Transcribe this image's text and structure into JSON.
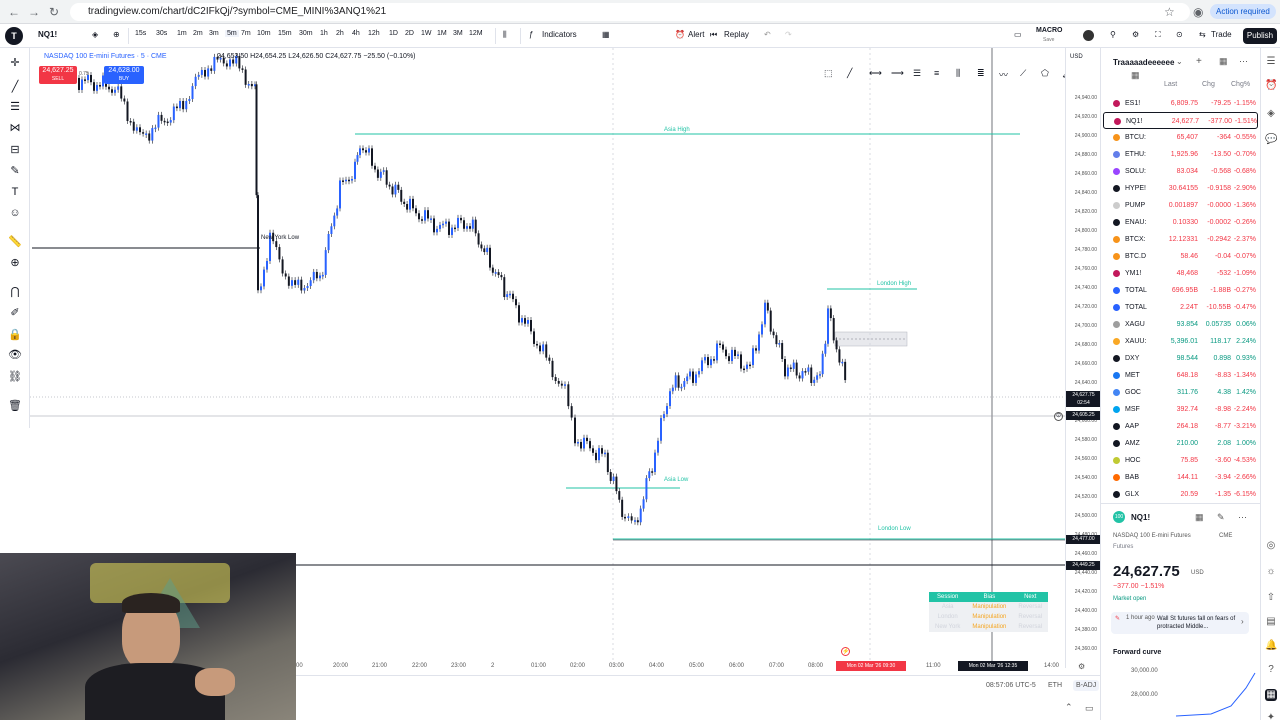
{
  "browser": {
    "url": "tradingview.com/chart/dC2IFkQj/?symbol=CME_MINI%3ANQ1%21",
    "action_required": "Action required"
  },
  "toolbar": {
    "symbol": "NQ1!",
    "intervals": [
      "15s",
      "30s",
      "1m",
      "2m",
      "3m",
      "5m",
      "7m",
      "10m",
      "15m",
      "30m",
      "1h",
      "2h",
      "4h",
      "12h",
      "1D",
      "2D",
      "1W",
      "1M",
      "3M",
      "12M"
    ],
    "indicators": "Indicators",
    "alert": "Alert",
    "replay": "Replay",
    "macro": "MACRO",
    "macro_sub": "Save",
    "trade": "Trade",
    "publish": "Publish"
  },
  "legend": {
    "title": "NASDAQ 100 E-mini Futures · 5 · CME",
    "ohlc": "24,653.50  H24,654.25  L24,626.50  C24,627.75  −25.50 (−0.10%)",
    "sell_price": "24,627.25",
    "sell_label": "SELL",
    "buy_price": "24,628.00",
    "buy_label": "BUY",
    "spread": "0.75"
  },
  "chart_labels": {
    "asia_high": "Asia High",
    "asia_low": "Asia Low",
    "london_high": "London High",
    "london_low": "London Low",
    "ny_low": "New York Low",
    "drawing_title": "Traaaaadeeeeee"
  },
  "price_axis": {
    "currency": "USD",
    "ticks": [
      "24,940.00",
      "24,920.00",
      "24,900.00",
      "24,880.00",
      "24,860.00",
      "24,840.00",
      "24,820.00",
      "24,800.00",
      "24,780.00",
      "24,760.00",
      "24,740.00",
      "24,720.00",
      "24,700.00",
      "24,680.00",
      "24,660.00",
      "24,640.00",
      "24,620.00",
      "24,600.00",
      "24,580.00",
      "24,560.00",
      "24,540.00",
      "24,520.00",
      "24,500.00",
      "24,480.00",
      "24,460.00",
      "24,440.00",
      "24,420.00",
      "24,400.00",
      "24,380.00",
      "24,360.00"
    ],
    "current_price": "24,627.75",
    "current_countdown": "02:54",
    "crosshair_price": "24,605.25",
    "level_1": "24,477.00",
    "level_2": "24,449.25"
  },
  "time_axis": {
    "ticks": [
      "00",
      "20:00",
      "21:00",
      "22:00",
      "23:00",
      "2",
      "01:00",
      "02:00",
      "03:00",
      "04:00",
      "05:00",
      "06:00",
      "07:00",
      "08:00",
      "11:00",
      "14:00"
    ],
    "highlight_1": "Mon 02 Mar '26  09:30",
    "highlight_2": "Mon 02 Mar '26  12:35"
  },
  "session_table": {
    "headers": [
      "Session",
      "Bias",
      "Next"
    ],
    "rows": [
      [
        "Asia",
        "Manipulation",
        "Reversal"
      ],
      [
        "London",
        "Manipulation",
        "Reversal"
      ],
      [
        "New York",
        "Manipulation",
        "Reversal"
      ]
    ]
  },
  "bottom": {
    "clock": "08:57:06 UTC-5",
    "session": "ETH",
    "adj": "B-ADJ"
  },
  "watchlist": {
    "title": "Traaaaadeeeeee",
    "col_last": "Last",
    "col_chg": "Chg",
    "col_pct": "Chg%",
    "rows": [
      {
        "sym": "ES1!",
        "last": "6,809.75",
        "chg": "-79.25",
        "pct": "-1.15%",
        "dir": "dn",
        "color": "#c2185b"
      },
      {
        "sym": "NQ1!",
        "last": "24,627.7",
        "chg": "-377.00",
        "pct": "-1.51%",
        "dir": "dn",
        "color": "#c2185b"
      },
      {
        "sym": "BTCU:",
        "last": "65,407",
        "chg": "-364",
        "pct": "-0.55%",
        "dir": "dn",
        "color": "#f7931a"
      },
      {
        "sym": "ETHU:",
        "last": "1,925.96",
        "chg": "-13.50",
        "pct": "-0.70%",
        "dir": "dn",
        "color": "#627eea"
      },
      {
        "sym": "SOLU:",
        "last": "83.034",
        "chg": "-0.568",
        "pct": "-0.68%",
        "dir": "dn",
        "color": "#9945ff"
      },
      {
        "sym": "HYPE!",
        "last": "30.64155",
        "chg": "-0.9158",
        "pct": "-2.90%",
        "dir": "dn",
        "color": "#131722"
      },
      {
        "sym": "PUMP",
        "last": "0.001897",
        "chg": "-0.0000",
        "pct": "-1.36%",
        "dir": "dn",
        "color": "#cccccc"
      },
      {
        "sym": "ENAU:",
        "last": "0.10330",
        "chg": "-0.0002",
        "pct": "-0.26%",
        "dir": "dn",
        "color": "#131722"
      },
      {
        "sym": "BTCX:",
        "last": "12.12331",
        "chg": "-0.2942",
        "pct": "-2.37%",
        "dir": "dn",
        "color": "#f7931a"
      },
      {
        "sym": "BTC.D",
        "last": "58.46",
        "chg": "-0.04",
        "pct": "-0.07%",
        "dir": "dn",
        "color": "#f7931a"
      },
      {
        "sym": "YM1!",
        "last": "48,468",
        "chg": "-532",
        "pct": "-1.09%",
        "dir": "dn",
        "color": "#c2185b"
      },
      {
        "sym": "TOTAL",
        "last": "696.95B",
        "chg": "-1.88B",
        "pct": "-0.27%",
        "dir": "dn",
        "color": "#2962ff"
      },
      {
        "sym": "TOTAL",
        "last": "2.24T",
        "chg": "-10.55B",
        "pct": "-0.47%",
        "dir": "dn",
        "color": "#2962ff"
      },
      {
        "sym": "XAGU",
        "last": "93.854",
        "chg": "0.05735",
        "pct": "0.06%",
        "dir": "up",
        "color": "#9e9e9e"
      },
      {
        "sym": "XAUU:",
        "last": "5,396.01",
        "chg": "118.17",
        "pct": "2.24%",
        "dir": "up",
        "color": "#f9a825"
      },
      {
        "sym": "DXY",
        "last": "98.544",
        "chg": "0.898",
        "pct": "0.93%",
        "dir": "up",
        "color": "#131722"
      },
      {
        "sym": "MET",
        "last": "648.18",
        "chg": "-8.83",
        "pct": "-1.34%",
        "dir": "dn",
        "color": "#1877f2"
      },
      {
        "sym": "GOC",
        "last": "311.76",
        "chg": "4.38",
        "pct": "1.42%",
        "dir": "up",
        "color": "#4285f4"
      },
      {
        "sym": "MSF",
        "last": "392.74",
        "chg": "-8.98",
        "pct": "-2.24%",
        "dir": "dn",
        "color": "#00a4ef"
      },
      {
        "sym": "AAP",
        "last": "264.18",
        "chg": "-8.77",
        "pct": "-3.21%",
        "dir": "dn",
        "color": "#131722"
      },
      {
        "sym": "AMZ",
        "last": "210.00",
        "chg": "2.08",
        "pct": "1.00%",
        "dir": "up",
        "color": "#131722"
      },
      {
        "sym": "HOC",
        "last": "75.85",
        "chg": "-3.60",
        "pct": "-4.53%",
        "dir": "dn",
        "color": "#c0ca33"
      },
      {
        "sym": "BAB",
        "last": "144.11",
        "chg": "-3.94",
        "pct": "-2.66%",
        "dir": "dn",
        "color": "#ff6a00"
      },
      {
        "sym": "GLX",
        "last": "20.59",
        "chg": "-1.35",
        "pct": "-6.15%",
        "dir": "dn",
        "color": "#131722"
      }
    ]
  },
  "details": {
    "symbol": "NQ1!",
    "name": "NASDAQ 100 E-mini Futures",
    "exchange": "CME",
    "sub": "Futures",
    "price": "24,627.75",
    "currency": "USD",
    "change": "−377.00  −1.51%",
    "status": "Market open",
    "news_time": "1 hour ago",
    "news": "Wall St futures fall on fears of protracted Middle...",
    "forward_curve": "Forward curve",
    "fc_tick_1": "30,000.00",
    "fc_tick_2": "28,000.00"
  },
  "colors": {
    "green": "#089981",
    "red": "#f23645",
    "blue": "#2962ff",
    "teal": "#22c3a6",
    "orange": "#f5a623"
  }
}
